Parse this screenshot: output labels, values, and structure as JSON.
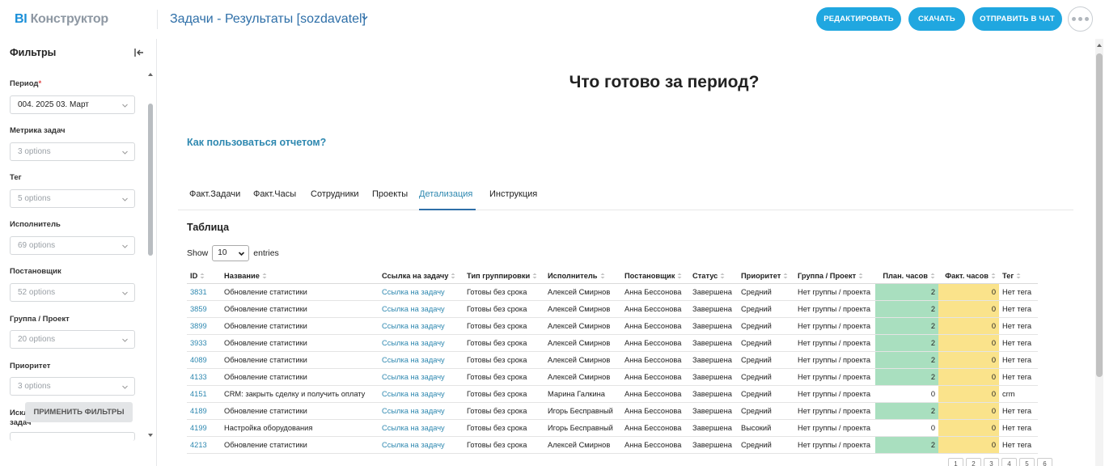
{
  "header": {
    "logo_bi": "BI",
    "logo_rest": "Конструктор",
    "title": "Задачи - Результаты [sozdavatel]",
    "buttons": {
      "edit": "Редактировать",
      "download": "Скачать",
      "send": "Отправить в чат"
    }
  },
  "sidebar": {
    "title": "Фильтры",
    "apply": "Применить фильтры",
    "filters": [
      {
        "label": "Период",
        "required": "*",
        "value": "004. 2025 03. Март"
      },
      {
        "label": "Метрика задач",
        "value": "3 options"
      },
      {
        "label": "Тег",
        "value": "5 options"
      },
      {
        "label": "Исполнитель",
        "value": "69 options"
      },
      {
        "label": "Постановщик",
        "value": "52 options"
      },
      {
        "label": "Группа / Проект",
        "value": "20 options"
      },
      {
        "label": "Приоритет",
        "value": "3 options"
      },
      {
        "label": "Исключить: Метрика задач",
        "value": ""
      }
    ]
  },
  "report": {
    "title": "Что готово за период?",
    "how_to": "Как пользоваться отчетом?",
    "tabs": [
      "Факт.Задачи",
      "Факт.Часы",
      "Сотрудники",
      "Проекты",
      "Детализация",
      "Инструкция"
    ],
    "active_tab": "Детализация",
    "table_heading": "Таблица",
    "show_label": "Show",
    "entries_value": "10",
    "entries_label": "entries"
  },
  "table": {
    "columns": [
      "ID",
      "Название",
      "Ссылка на задачу",
      "Тип группировки",
      "Исполнитель",
      "Постановщик",
      "Статус",
      "Приоритет",
      "Группа / Проект",
      "План. часов",
      "Факт. часов",
      "Тег"
    ],
    "rows": [
      [
        "3831",
        "Обновление статистики",
        "Ссылка на задачу",
        "Готовы без срока",
        "Алексей Смирнов",
        "Анна Бессонова",
        "Завершена",
        "Средний",
        "Нет группы / проекта",
        "2",
        "0",
        "Нет тега"
      ],
      [
        "3859",
        "Обновление статистики",
        "Ссылка на задачу",
        "Готовы без срока",
        "Алексей Смирнов",
        "Анна Бессонова",
        "Завершена",
        "Средний",
        "Нет группы / проекта",
        "2",
        "0",
        "Нет тега"
      ],
      [
        "3899",
        "Обновление статистики",
        "Ссылка на задачу",
        "Готовы без срока",
        "Алексей Смирнов",
        "Анна Бессонова",
        "Завершена",
        "Средний",
        "Нет группы / проекта",
        "2",
        "0",
        "Нет тега"
      ],
      [
        "3933",
        "Обновление статистики",
        "Ссылка на задачу",
        "Готовы без срока",
        "Алексей Смирнов",
        "Анна Бессонова",
        "Завершена",
        "Средний",
        "Нет группы / проекта",
        "2",
        "0",
        "Нет тега"
      ],
      [
        "4089",
        "Обновление статистики",
        "Ссылка на задачу",
        "Готовы без срока",
        "Алексей Смирнов",
        "Анна Бессонова",
        "Завершена",
        "Средний",
        "Нет группы / проекта",
        "2",
        "0",
        "Нет тега"
      ],
      [
        "4133",
        "Обновление статистики",
        "Ссылка на задачу",
        "Готовы без срока",
        "Алексей Смирнов",
        "Анна Бессонова",
        "Завершена",
        "Средний",
        "Нет группы / проекта",
        "2",
        "0",
        "Нет тега"
      ],
      [
        "4151",
        "CRM: закрыть сделку и получить оплату",
        "Ссылка на задачу",
        "Готовы без срока",
        "Марина Галкина",
        "Анна Бессонова",
        "Завершена",
        "Средний",
        "Нет группы / проекта",
        "0",
        "0",
        "crm"
      ],
      [
        "4189",
        "Обновление статистики",
        "Ссылка на задачу",
        "Готовы без срока",
        "Игорь Бесправный",
        "Анна Бессонова",
        "Завершена",
        "Средний",
        "Нет группы / проекта",
        "2",
        "0",
        "Нет тега"
      ],
      [
        "4199",
        "Настройка оборудования",
        "Ссылка на задачу",
        "Готовы без срока",
        "Игорь Бесправный",
        "Анна Бессонова",
        "Завершена",
        "Высокий",
        "Нет группы / проекта",
        "0",
        "0",
        "Нет тега"
      ],
      [
        "4213",
        "Обновление статистики",
        "Ссылка на задачу",
        "Готовы без срока",
        "Алексей Смирнов",
        "Анна Бессонова",
        "Завершена",
        "Средний",
        "Нет группы / проекта",
        "2",
        "0",
        "Нет тега"
      ]
    ]
  },
  "pager": [
    "1",
    "2",
    "3",
    "4",
    "5",
    "6"
  ],
  "colors": {
    "accent": "#20a7e0",
    "link": "#2e88b0",
    "plan_bg": "#a9dfbf",
    "fact_bg": "#fae38b"
  }
}
